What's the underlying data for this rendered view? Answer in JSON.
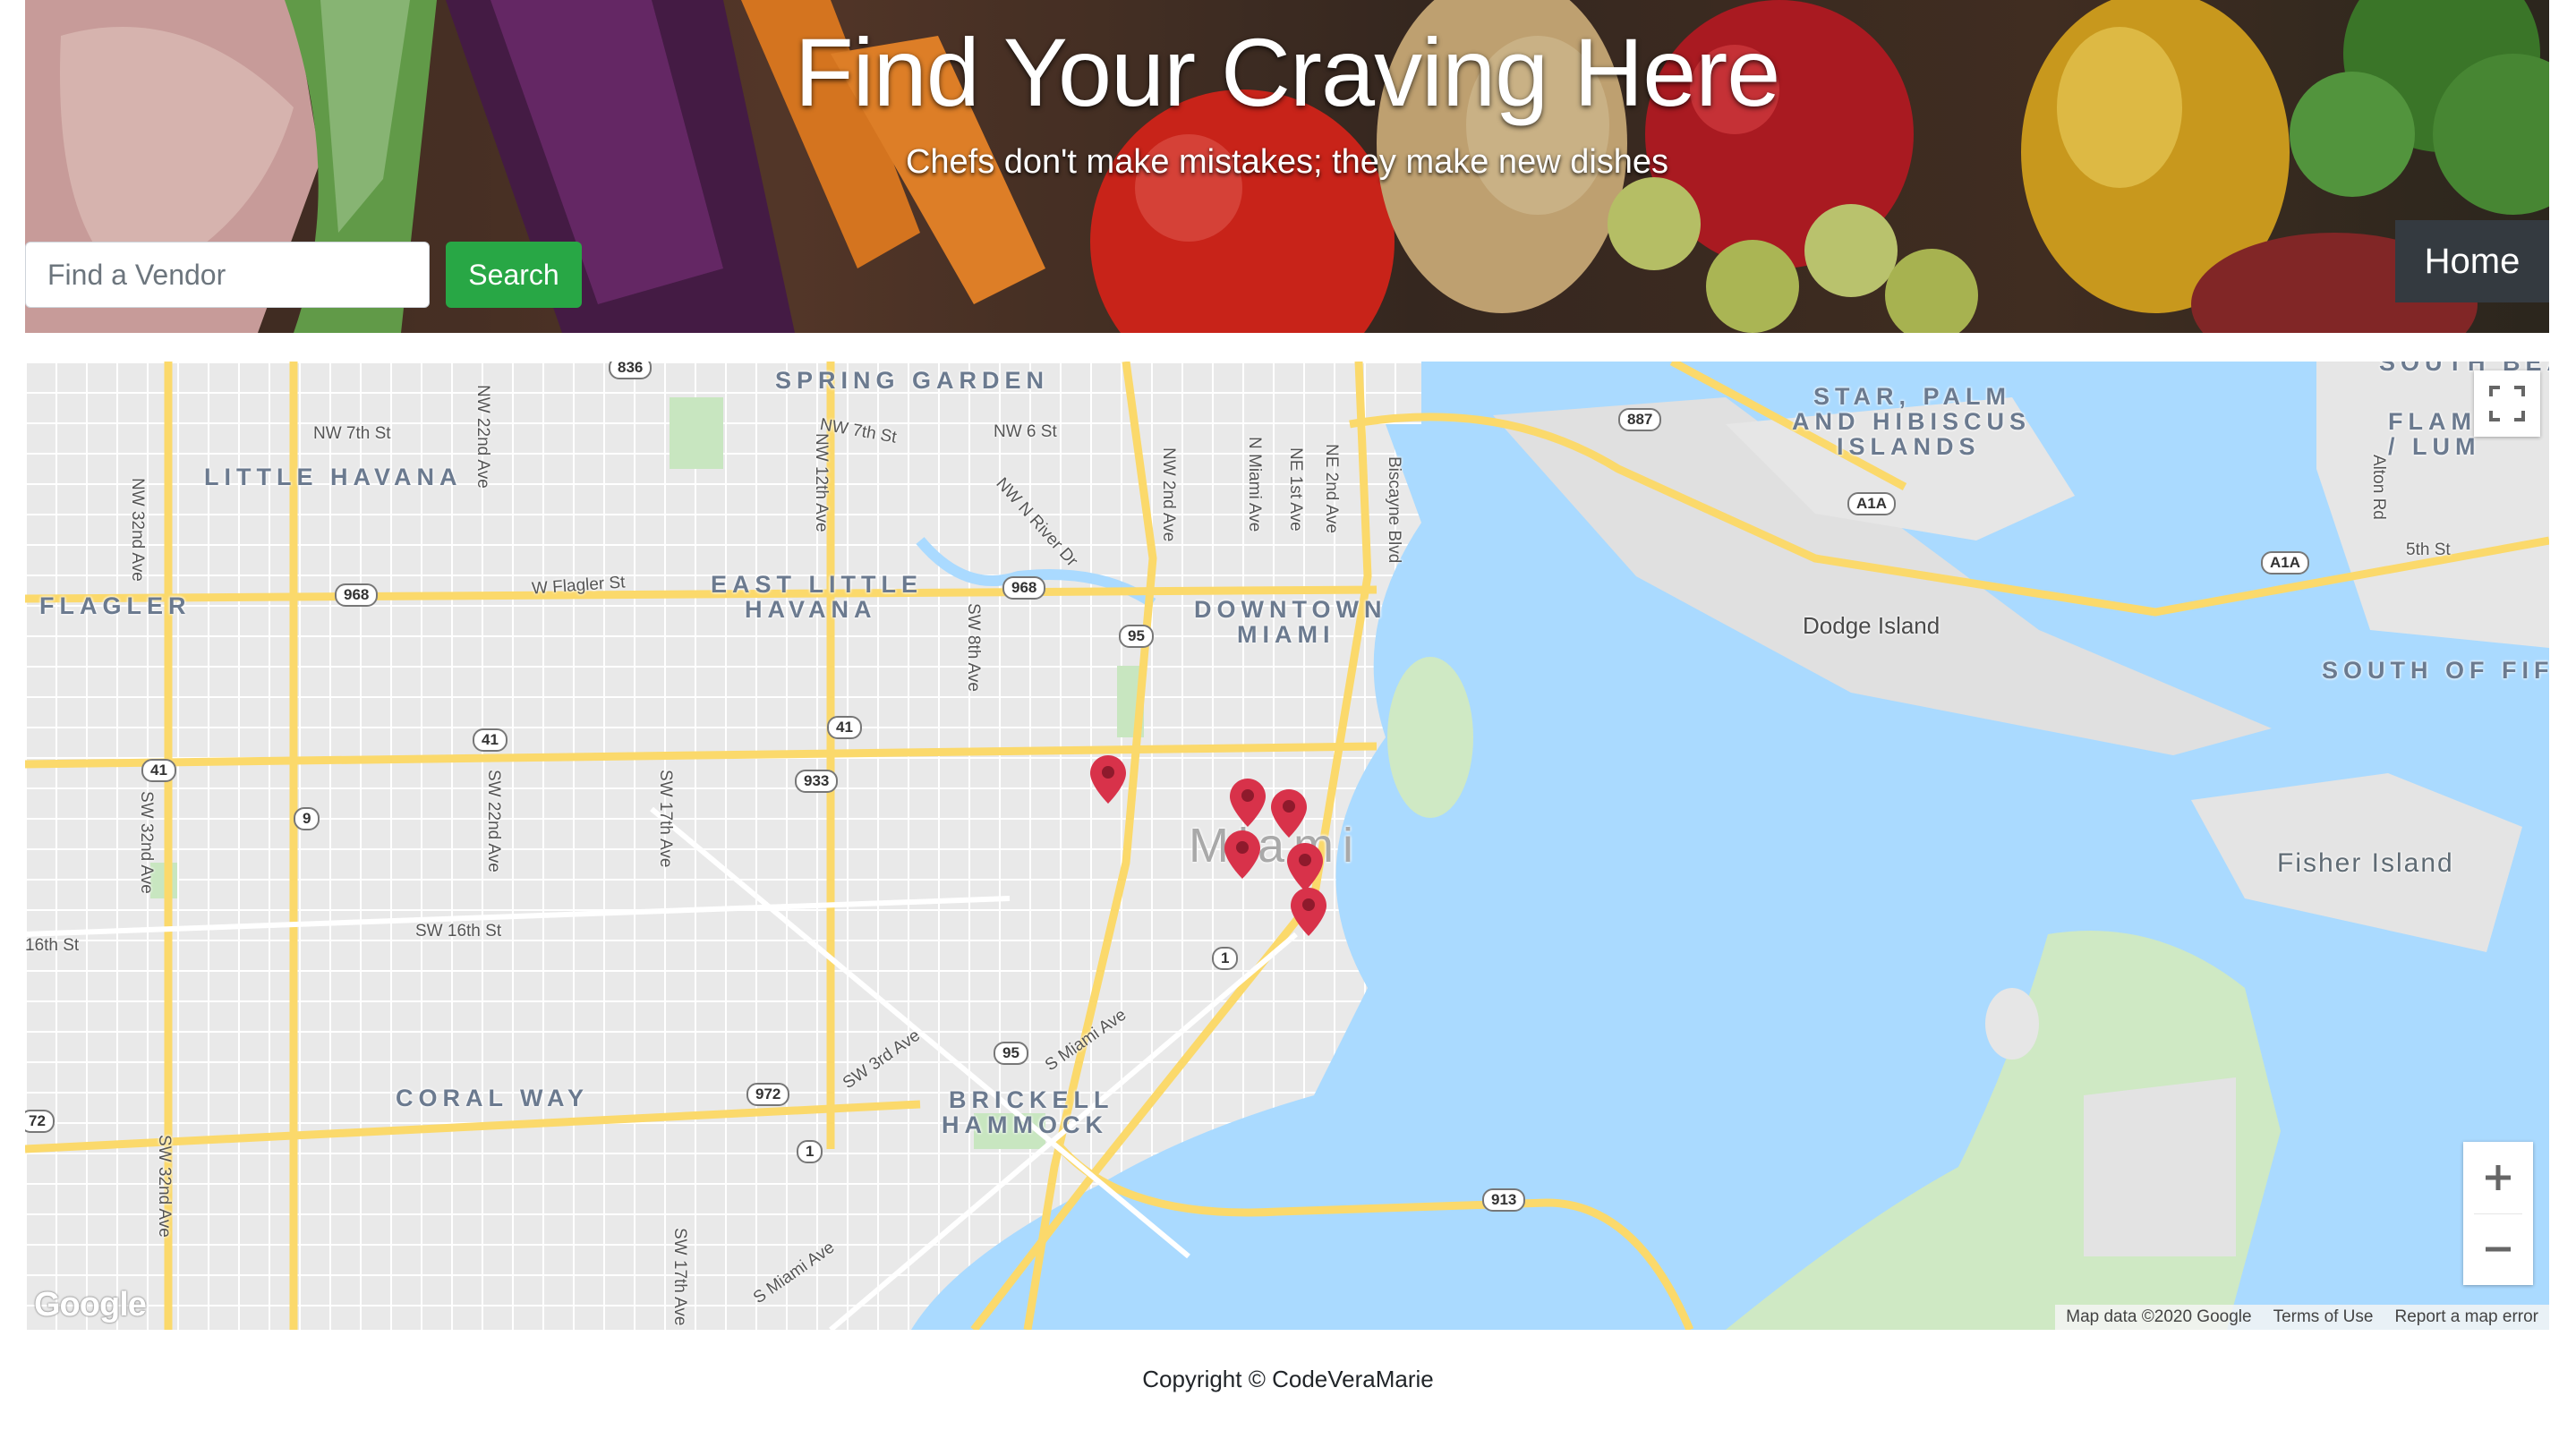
{
  "hero": {
    "title": "Find Your Craving Here",
    "subtitle": "Chefs don't make mistakes; they make new dishes",
    "search_placeholder": "Find a Vendor",
    "search_button": "Search",
    "home_button": "Home"
  },
  "map": {
    "neighborhoods": {
      "spring_garden": "SPRING GARDEN",
      "little_havana": "LITTLE HAVANA",
      "flagler": "FLAGLER",
      "east_little_havana_1": "EAST LITTLE",
      "east_little_havana_2": "HAVANA",
      "downtown_1": "DOWNTOWN",
      "downtown_2": "MIAMI",
      "coral_way": "CORAL WAY",
      "brickell_1": "BRICKELL",
      "brickell_2": "HAMMOCK",
      "star_palm_1": "STAR, PALM",
      "star_palm_2": "AND HIBISCUS",
      "star_palm_3": "ISLANDS",
      "south_of_fifth": "SOUTH OF FIFT",
      "flamingo_1": "FLAM",
      "flamingo_2": "/ LUM",
      "south_beach": "SOUTH BEA",
      "city": "Miami",
      "dodge_island": "Dodge Island",
      "fisher_island": "Fisher Island"
    },
    "streets": {
      "nw7th": "NW 7th St",
      "nw7th_b": "NW 7th St",
      "nw6th": "NW 6 St",
      "nw_river": "NW N River Dr",
      "nw22nd": "NW 22nd Ave",
      "nw12th": "NW 12th Ave",
      "nw32nd": "NW 32nd Ave",
      "nw2nd": "NW 2nd Ave",
      "n_miami": "N Miami Ave",
      "ne1st": "NE 1st Ave",
      "ne2nd": "NE 2nd Ave",
      "biscayne": "Biscayne Blvd",
      "w_flagler": "W Flagler St",
      "sw8th": "SW 8th Ave",
      "sw32nd": "SW 32nd Ave",
      "sw22nd": "SW 22nd Ave",
      "sw17th": "SW 17th Ave",
      "sw16th": "SW 16th St",
      "sixteenth": "16th St",
      "sw3rd": "SW 3rd Ave",
      "s_miami": "S Miami Ave",
      "sw32nd_b": "SW 32nd Ave",
      "sw17th_b": "SW 17th Ave",
      "s_miami_b": "S Miami Ave",
      "alton": "Alton Rd",
      "fifth": "5th St"
    },
    "shields": {
      "r836": "836",
      "r887": "887",
      "r968a": "968",
      "r968b": "968",
      "i95a": "95",
      "us41a": "41",
      "us41b": "41",
      "us41c": "41",
      "r9": "9",
      "r933": "933",
      "us1a": "1",
      "us1b": "1",
      "i95b": "95",
      "r972": "972",
      "r913": "913",
      "a1a1": "A1A",
      "a1a2": "A1A",
      "r72": "72"
    },
    "markers": [
      {
        "name": "vendor-1"
      },
      {
        "name": "vendor-2"
      },
      {
        "name": "vendor-3"
      },
      {
        "name": "vendor-4"
      },
      {
        "name": "vendor-5"
      },
      {
        "name": "vendor-6"
      }
    ],
    "fullscreen_icon": "fullscreen-icon",
    "zoom_in": "+",
    "zoom_out": "−",
    "google_logo": "Google",
    "attribution": {
      "map_data": "Map data ©2020 Google",
      "terms": "Terms of Use",
      "report": "Report a map error"
    },
    "colors": {
      "water": "#aadaff",
      "land": "#e8e8e8",
      "highway": "#fbd96b",
      "park": "#c8e6c0",
      "marker": "#d8324a"
    }
  },
  "footer": {
    "copyright": "Copyright © CodeVeraMarie"
  }
}
